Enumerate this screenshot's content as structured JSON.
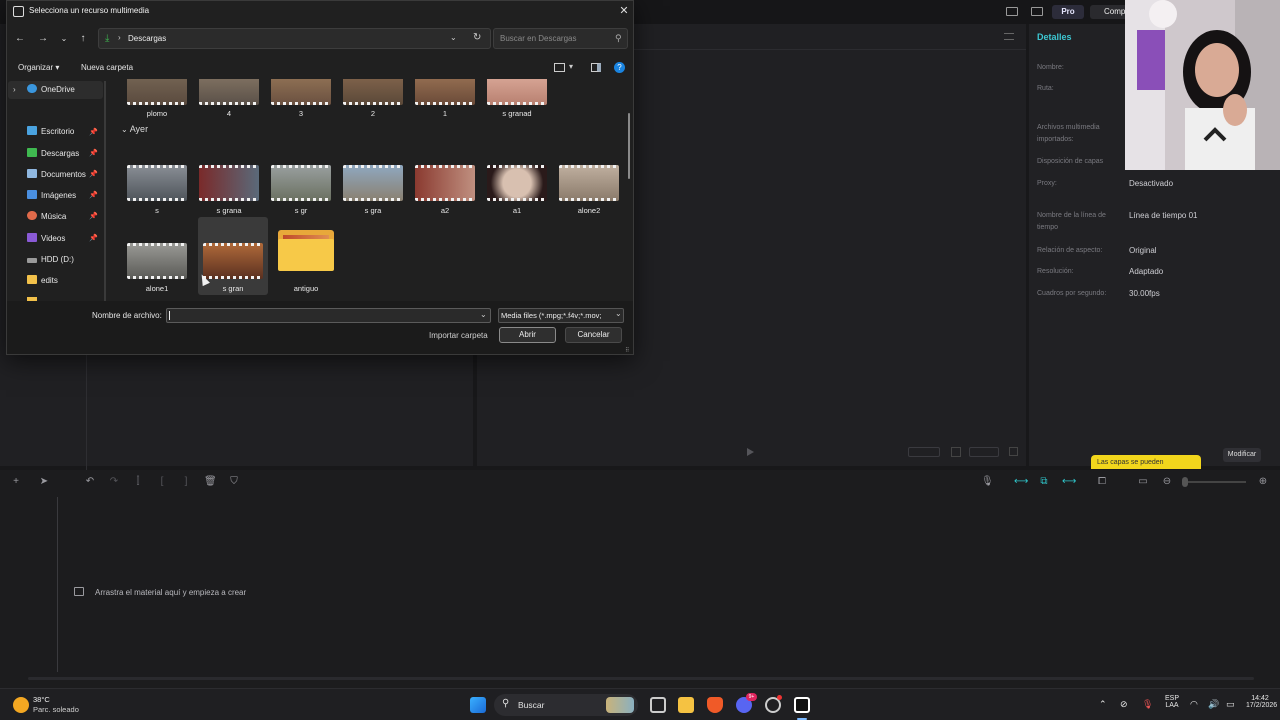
{
  "dialog": {
    "title": "Selecciona un recurso multimedia",
    "address": "Descargas",
    "search_placeholder": "Buscar en Descargas",
    "organize_label": "Organizar",
    "new_folder_label": "Nueva carpeta",
    "nav_items": [
      {
        "label": "OneDrive",
        "icon": "cloud-icon",
        "color": "#3a96dd",
        "pinned": false
      },
      {
        "label": "Escritorio",
        "icon": "desktop-icon",
        "color": "#4aa3e0",
        "pinned": true
      },
      {
        "label": "Descargas",
        "icon": "download-icon",
        "color": "#3fb950",
        "pinned": true
      },
      {
        "label": "Documentos",
        "icon": "document-icon",
        "color": "#8fb7e0",
        "pinned": true
      },
      {
        "label": "Imágenes",
        "icon": "image-icon",
        "color": "#4a8fe0",
        "pinned": true
      },
      {
        "label": "Música",
        "icon": "music-icon",
        "color": "#e06a4a",
        "pinned": true
      },
      {
        "label": "Videos",
        "icon": "video-icon",
        "color": "#8a5ad6",
        "pinned": true
      },
      {
        "label": "HDD (D:)",
        "icon": "drive-icon",
        "color": "#9a9a9a",
        "pinned": false
      },
      {
        "label": "edits",
        "icon": "folder-icon",
        "color": "#f2c14a",
        "pinned": false
      }
    ],
    "top_row_files": [
      "plomo",
      "4",
      "3",
      "2",
      "1",
      "s granad"
    ],
    "group_header": "Ayer",
    "yesterday_row1": [
      "s",
      "s grana",
      "s gr",
      "s gra",
      "a2",
      "a1",
      "alone2"
    ],
    "yesterday_row2": [
      "alone1",
      "s gran",
      "antiguo"
    ],
    "filename_label": "Nombre de archivo:",
    "filename_value": "",
    "file_type": "Media files (*.mpg;*.f4v;*.mov;",
    "import_folder_label": "Importar carpeta",
    "open_label": "Abrir",
    "cancel_label": "Cancelar"
  },
  "app": {
    "pro_label": "Pro",
    "comp_label": "Comp",
    "details": {
      "title": "Detalles",
      "rows": [
        {
          "label": "Nombre:",
          "value": ""
        },
        {
          "label": "Ruta:",
          "value": ""
        },
        {
          "label": "Archivos multimedia importados:",
          "value": ""
        },
        {
          "label": "Disposición de capas",
          "value": ""
        },
        {
          "label": "Proxy:",
          "value": "Desactivado"
        },
        {
          "label": "Nombre de la línea de tiempo",
          "value": "Línea de tiempo 01"
        },
        {
          "label": "Relación de aspecto:",
          "value": "Original"
        },
        {
          "label": "Resolución:",
          "value": "Adaptado"
        },
        {
          "label": "Cuadros por segundo:",
          "value": "30.00fps"
        }
      ],
      "modify_label": "Modificar",
      "layers_tip": "Las capas se pueden"
    },
    "timeline": {
      "drop_hint": "Arrastra el material aquí y empieza a crear"
    }
  },
  "taskbar": {
    "weather_temp": "38°C",
    "weather_desc": "Parc. soleado",
    "search_label": "Buscar",
    "lang_line1": "ESP",
    "lang_line2": "LAA",
    "time": "14:42",
    "date": "17/2/2026",
    "discord_badge": "9+"
  },
  "colors": {
    "accent_teal": "#2fc5c9",
    "tip_yellow": "#f2d61c",
    "folder_yellow": "#f7c948"
  }
}
